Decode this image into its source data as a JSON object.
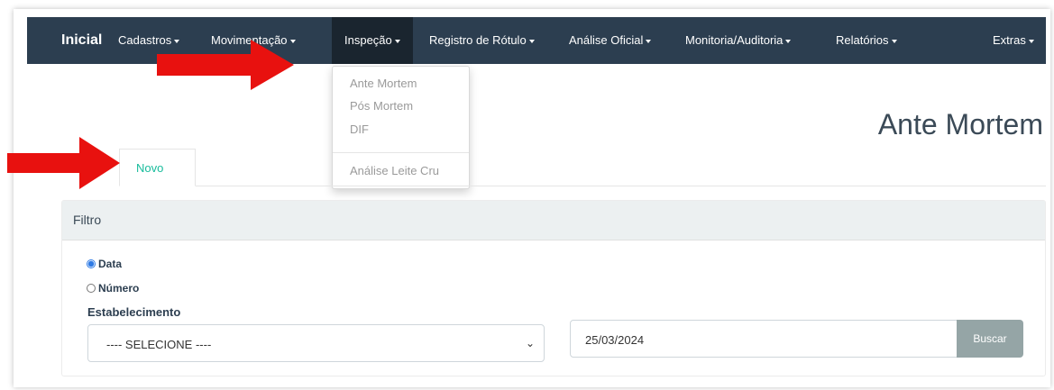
{
  "navbar": {
    "brand": "Inicial",
    "items": [
      {
        "label": "Cadastros",
        "dropdown": true
      },
      {
        "label": "Movimentação",
        "dropdown": true
      },
      {
        "label": "Inspeção",
        "dropdown": true,
        "active": true
      },
      {
        "label": "Registro de Rótulo",
        "dropdown": true
      },
      {
        "label": "Análise Oficial",
        "dropdown": true
      },
      {
        "label": "Monitoria/Auditoria",
        "dropdown": true
      },
      {
        "label": "Relatórios",
        "dropdown": true
      },
      {
        "label": "Extras",
        "dropdown": true
      }
    ]
  },
  "inspecao_menu": {
    "items": [
      "Ante Mortem",
      "Pós Mortem",
      "DIF",
      "Análise Leite Cru"
    ]
  },
  "page": {
    "title": "Ante Mortem",
    "tab_new": "Novo"
  },
  "filter": {
    "heading": "Filtro",
    "radio_options": [
      {
        "label": "Data",
        "checked": true
      },
      {
        "label": "Número",
        "checked": false
      }
    ],
    "establishment_label": "Estabelecimento",
    "establishment_value": "---- SELECIONE ----",
    "date_value": "25/03/2024",
    "search_button": "Buscar"
  },
  "annotations": {
    "arrow_color": "#e8110f"
  },
  "colors": {
    "navbar_bg": "#2c3e50",
    "accent_green": "#18bc9c",
    "button_gray": "#95a5a6"
  }
}
